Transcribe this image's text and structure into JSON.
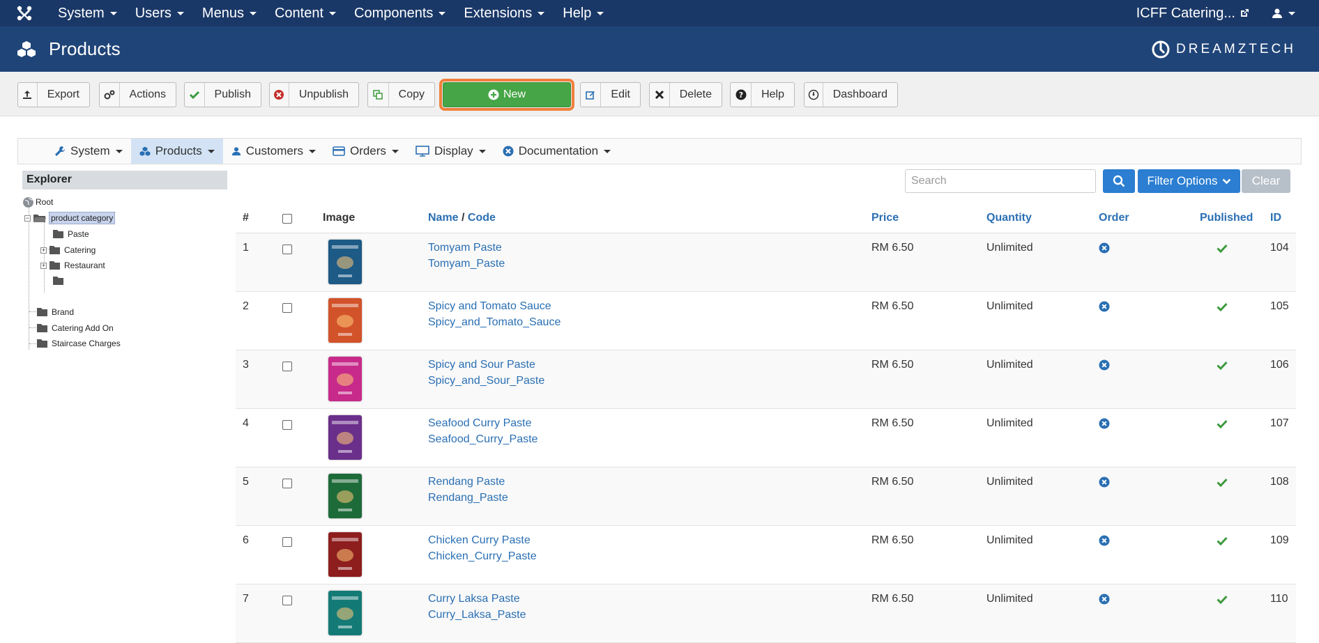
{
  "topnav": {
    "menu": [
      "System",
      "Users",
      "Menus",
      "Content",
      "Components",
      "Extensions",
      "Help"
    ],
    "site_name": "ICFF Catering..."
  },
  "header": {
    "title": "Products",
    "brand": "DREAMZTECH"
  },
  "toolbar": {
    "export": "Export",
    "actions": "Actions",
    "publish": "Publish",
    "unpublish": "Unpublish",
    "copy": "Copy",
    "new": "New",
    "edit": "Edit",
    "delete": "Delete",
    "help": "Help",
    "dashboard": "Dashboard"
  },
  "subnav": [
    "System",
    "Products",
    "Customers",
    "Orders",
    "Display",
    "Documentation"
  ],
  "explorer": {
    "title": "Explorer",
    "root": "Root",
    "category": "product category",
    "children": [
      "Paste",
      "Catering",
      "Restaurant"
    ],
    "others": [
      "Brand",
      "Catering Add On",
      "Staircase Charges"
    ]
  },
  "filters": {
    "search_placeholder": "Search",
    "filter_options": "Filter Options",
    "clear": "Clear"
  },
  "table": {
    "headers": {
      "num": "#",
      "image": "Image",
      "name": "Name",
      "sep": " / ",
      "code": "Code",
      "price": "Price",
      "quantity": "Quantity",
      "order": "Order",
      "published": "Published",
      "id": "ID"
    },
    "rows": [
      {
        "num": "1",
        "name": "Tomyam Paste",
        "code": "Tomyam_Paste",
        "price": "RM 6.50",
        "qty": "Unlimited",
        "id": "104",
        "color": "#1d5a86"
      },
      {
        "num": "2",
        "name": "Spicy and Tomato Sauce",
        "code": "Spicy_and_Tomato_Sauce",
        "price": "RM 6.50",
        "qty": "Unlimited",
        "id": "105",
        "color": "#d2532a"
      },
      {
        "num": "3",
        "name": "Spicy and Sour Paste",
        "code": "Spicy_and_Sour_Paste",
        "price": "RM 6.50",
        "qty": "Unlimited",
        "id": "106",
        "color": "#c72a8a"
      },
      {
        "num": "4",
        "name": "Seafood Curry Paste",
        "code": "Seafood_Curry_Paste",
        "price": "RM 6.50",
        "qty": "Unlimited",
        "id": "107",
        "color": "#6a2f8a"
      },
      {
        "num": "5",
        "name": "Rendang Paste",
        "code": "Rendang_Paste",
        "price": "RM 6.50",
        "qty": "Unlimited",
        "id": "108",
        "color": "#1e6b3a"
      },
      {
        "num": "6",
        "name": "Chicken Curry Paste",
        "code": "Chicken_Curry_Paste",
        "price": "RM 6.50",
        "qty": "Unlimited",
        "id": "109",
        "color": "#8e1e1e"
      },
      {
        "num": "7",
        "name": "Curry Laksa Paste",
        "code": "Curry_Laksa_Paste",
        "price": "RM 6.50",
        "qty": "Unlimited",
        "id": "110",
        "color": "#147a76"
      }
    ]
  },
  "colors": {
    "navbar": "#1a3867",
    "header": "#1f4478",
    "link": "#2a6fb3",
    "new_button": "#46a546",
    "highlight": "#f0803c",
    "published": "#3c9a3c"
  }
}
